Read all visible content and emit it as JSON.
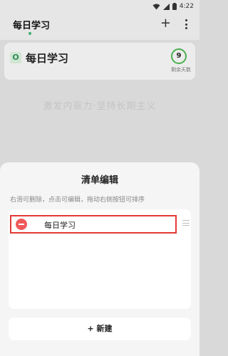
{
  "status_bar": {
    "time": "4:22"
  },
  "header": {
    "tab_title": "每日学习",
    "add_symbol": "+"
  },
  "list_card": {
    "badge": "O",
    "title": "每日学习",
    "days_value": "9",
    "days_label": "剩余天数"
  },
  "motto": "激发内驱力·坚持长期主义",
  "sheet": {
    "title": "清单编辑",
    "hint": "右滑可删除，点击可编辑，拖动右侧按钮可排序",
    "items": [
      {
        "label": "每日学习"
      }
    ],
    "new_button_label": "+ 新建"
  },
  "colors": {
    "accent_green": "#4caf50",
    "delete_red": "#f05a5a",
    "highlight_red": "#e53935"
  }
}
